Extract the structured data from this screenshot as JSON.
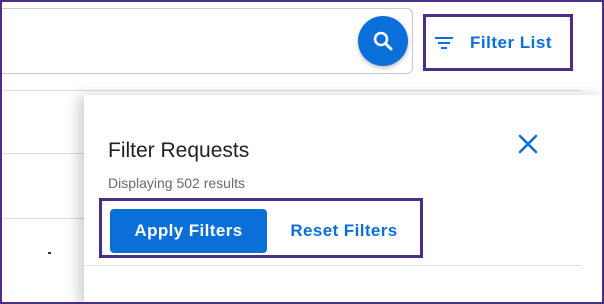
{
  "toolbar": {
    "search_icon": "search-icon",
    "filter_icon": "filter-icon",
    "filter_list_label": "Filter List"
  },
  "panel": {
    "title": "Filter Requests",
    "subtitle": "Displaying 502 results",
    "close_icon": "close-icon",
    "apply_label": "Apply Filters",
    "reset_label": "Reset Filters"
  },
  "colors": {
    "accent": "#0a6fd9",
    "highlight_border": "#4b2e83"
  }
}
